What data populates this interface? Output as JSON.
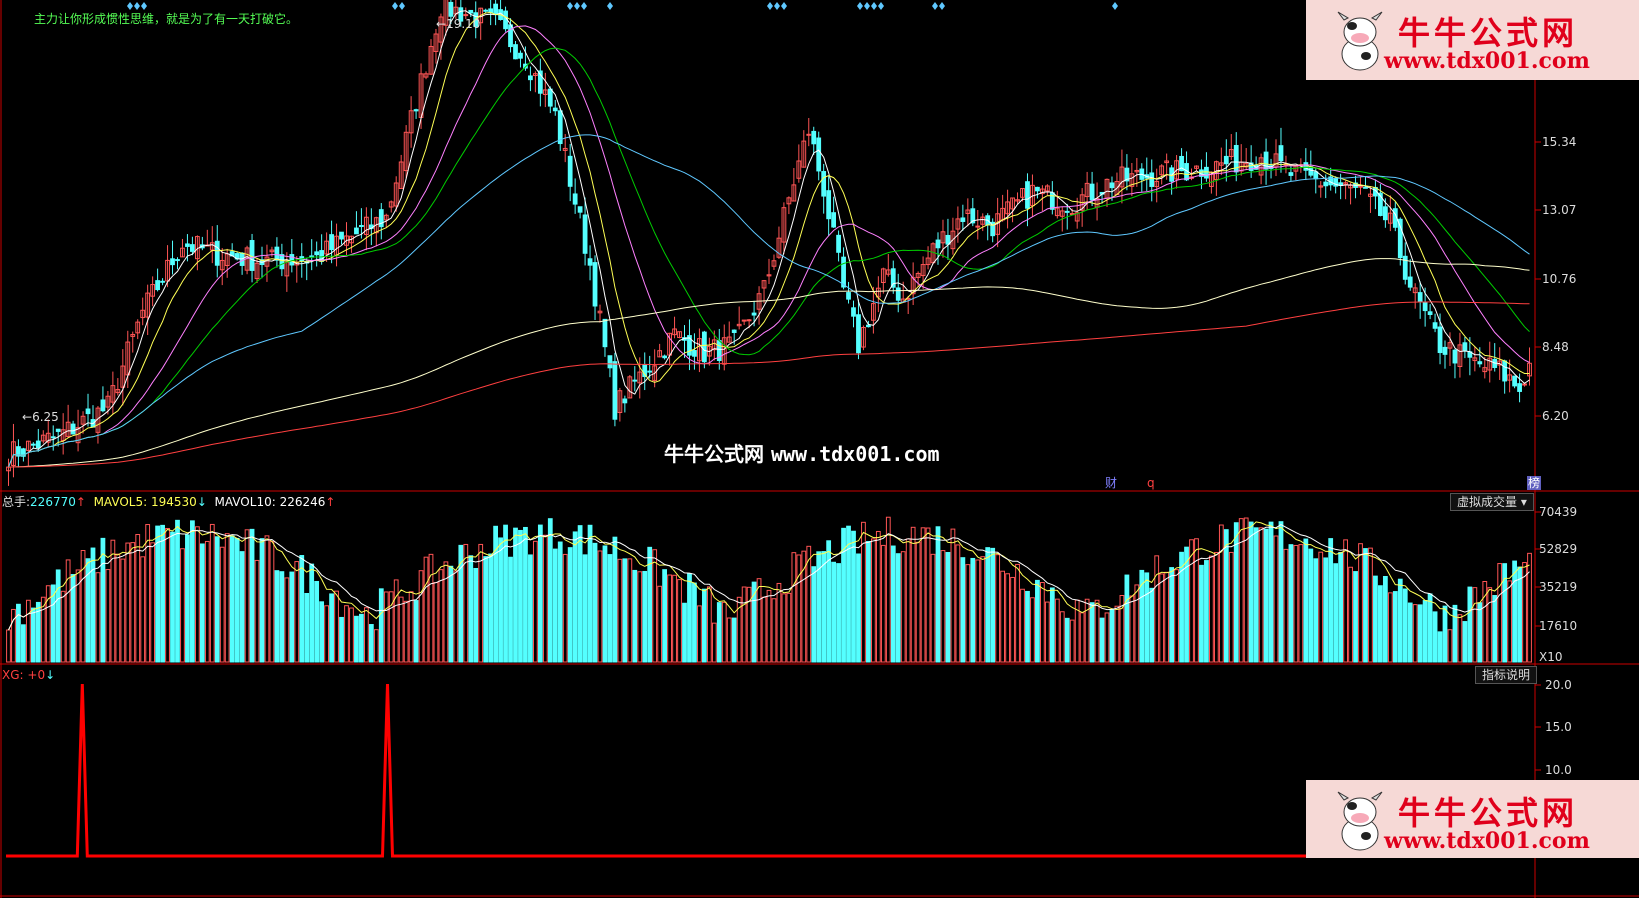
{
  "header_text": "主力让你形成惯性思维，就是为了有一天打破它。",
  "peak_label": "19.10",
  "low_label": "6.25",
  "price_ticks": [
    "15.34",
    "13.07",
    "10.76",
    "8.48",
    "6.20"
  ],
  "fin_label": "财",
  "q_label": "q",
  "bang_label": "榜",
  "vol_header": {
    "zs_label": "总手:",
    "zs_value": "226770",
    "ma5_label": "MAVOL5:",
    "ma5_value": "194530",
    "ma10_label": "MAVOL10:",
    "ma10_value": "226246"
  },
  "vol_ticks": [
    "70439",
    "52829",
    "35219",
    "17610",
    "X10"
  ],
  "vol_dropdown": "虚拟成交量",
  "xg_header": {
    "label": "XG:",
    "value": "+0"
  },
  "xg_ticks": [
    "20.0",
    "15.0",
    "10.0"
  ],
  "xg_button": "指标说明",
  "watermark": {
    "cn": "牛牛公式网",
    "url": "www.tdx001.com"
  },
  "logo": {
    "cn": "牛牛公式网",
    "url": "www.tdx001.com"
  },
  "colors": {
    "up": "#ff5555",
    "down": "#54ffff",
    "axis": "#cc0000",
    "ma5": "#ffffff",
    "ma10": "#ffff55",
    "ma20": "#ff80ff",
    "ma30": "#00cc00",
    "ma60": "#5fc8ff",
    "ma120": "#ffffcc",
    "ma250": "#ff4040"
  },
  "chart_data": [
    {
      "type": "candlestick",
      "title": "",
      "ylim": [
        6.2,
        19.1
      ],
      "y_ticks": [
        15.34,
        13.07,
        10.76,
        8.48,
        6.2
      ],
      "annotations": [
        {
          "text": "19.10",
          "kind": "high"
        },
        {
          "text": "6.25",
          "kind": "low"
        }
      ],
      "anchors": [
        [
          0,
          6.3
        ],
        [
          10,
          6.8
        ],
        [
          20,
          7.6
        ],
        [
          27,
          10.2
        ],
        [
          35,
          12.1
        ],
        [
          42,
          11.8
        ],
        [
          52,
          11.6
        ],
        [
          62,
          11.7
        ],
        [
          68,
          12.2
        ],
        [
          76,
          12.8
        ],
        [
          82,
          16.0
        ],
        [
          87,
          18.6
        ],
        [
          92,
          18.4
        ],
        [
          98,
          18.1
        ],
        [
          104,
          17.2
        ],
        [
          110,
          15.6
        ],
        [
          117,
          11.5
        ],
        [
          122,
          7.6
        ],
        [
          128,
          8.6
        ],
        [
          134,
          9.6
        ],
        [
          140,
          9.1
        ],
        [
          146,
          9.3
        ],
        [
          152,
          10.8
        ],
        [
          158,
          13.8
        ],
        [
          161,
          15.2
        ],
        [
          164,
          13.6
        ],
        [
          168,
          10.8
        ],
        [
          171,
          9.3
        ],
        [
          176,
          11.2
        ],
        [
          180,
          10.6
        ],
        [
          186,
          11.9
        ],
        [
          192,
          12.9
        ],
        [
          198,
          12.6
        ],
        [
          206,
          13.5
        ],
        [
          214,
          13.2
        ],
        [
          222,
          13.8
        ],
        [
          232,
          14.0
        ],
        [
          242,
          14.2
        ],
        [
          252,
          14.5
        ],
        [
          258,
          14.0
        ],
        [
          266,
          13.7
        ],
        [
          272,
          13.5
        ],
        [
          278,
          12.6
        ],
        [
          283,
          10.6
        ],
        [
          288,
          9.3
        ],
        [
          295,
          8.8
        ],
        [
          300,
          8.6
        ],
        [
          304,
          8.1
        ],
        [
          306,
          8.8
        ]
      ],
      "n_candles": 307,
      "moving_averages": [
        {
          "name": "MA5",
          "period": 5
        },
        {
          "name": "MA10",
          "period": 10
        },
        {
          "name": "MA20",
          "period": 20
        },
        {
          "name": "MA30",
          "period": 30
        },
        {
          "name": "MA60",
          "period": 60
        },
        {
          "name": "MA120",
          "period": 120
        },
        {
          "name": "MA250",
          "period": 250
        }
      ]
    },
    {
      "type": "bar",
      "title": "",
      "ylim": [
        0,
        70439
      ],
      "y_ticks": [
        70439,
        52829,
        35219,
        17610
      ],
      "series": [
        {
          "name": "总手",
          "last": 226770
        },
        {
          "name": "MAVOL5",
          "last": 194530
        },
        {
          "name": "MAVOL10",
          "last": 226246
        }
      ]
    },
    {
      "type": "line",
      "title": "",
      "ylim": [
        0,
        20
      ],
      "y_ticks": [
        20.0,
        15.0,
        10.0
      ],
      "series": [
        {
          "name": "XG",
          "last": 0,
          "spikes": [
            {
              "x_frac": 0.05,
              "value": 20
            },
            {
              "x_frac": 0.25,
              "value": 20
            }
          ]
        }
      ]
    }
  ]
}
